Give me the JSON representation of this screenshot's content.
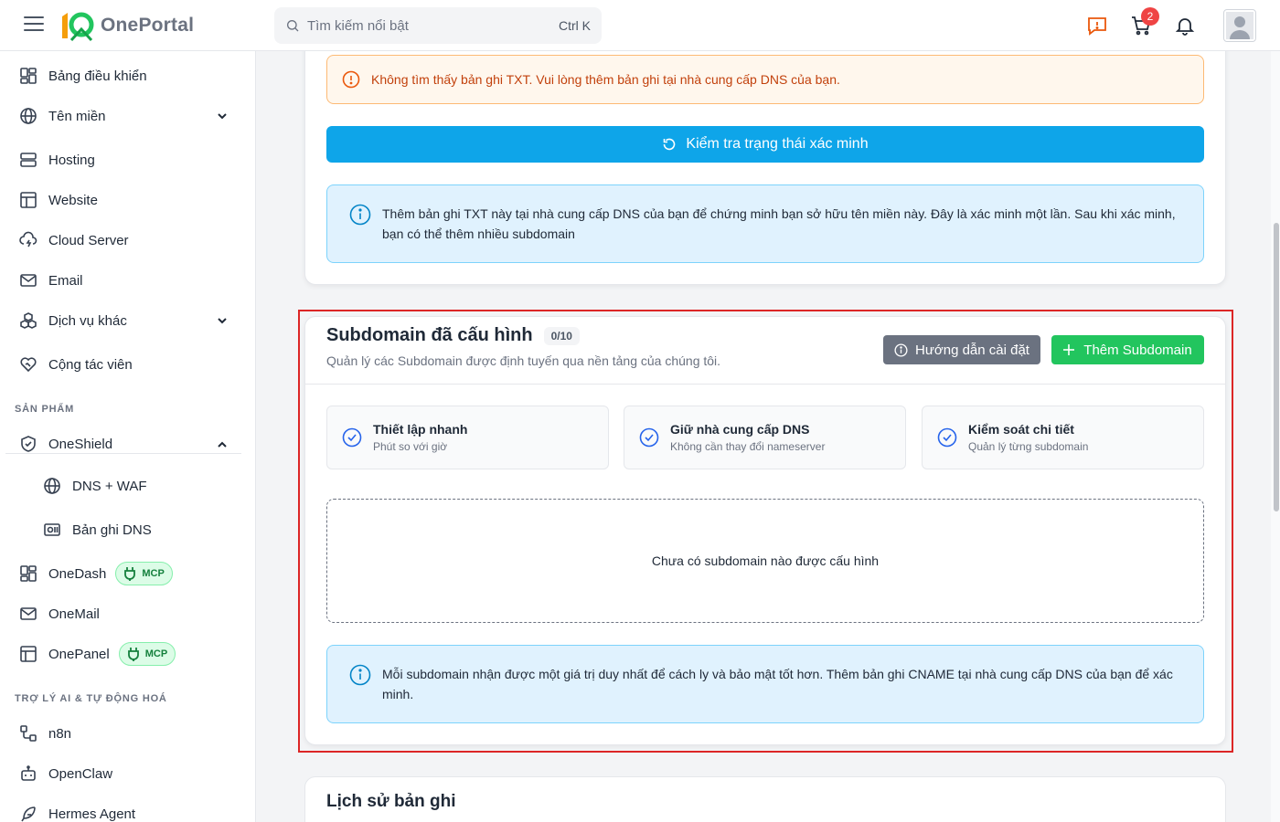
{
  "app": {
    "logo_text": "OnePortal",
    "search_placeholder": "Tìm kiếm nổi bật",
    "search_shortcut": "Ctrl K",
    "cart_count": "2",
    "colors": {
      "primary": "#0ea5e9",
      "success": "#22c55e",
      "danger": "#ef4444",
      "warning": "#c2410c"
    }
  },
  "sidebar": {
    "items": [
      {
        "label": "Bảng điều khiển",
        "icon": "dashboard-icon"
      },
      {
        "label": "Tên miền",
        "icon": "globe-icon",
        "expandable": true
      },
      {
        "label": "Hosting",
        "icon": "server-icon"
      },
      {
        "label": "Website",
        "icon": "website-icon"
      },
      {
        "label": "Cloud Server",
        "icon": "cloud-icon"
      },
      {
        "label": "Email",
        "icon": "mail-icon"
      },
      {
        "label": "Dịch vụ khác",
        "icon": "boxes-icon",
        "expandable": true
      },
      {
        "label": "Cộng tác viên",
        "icon": "heart-handshake-icon"
      }
    ],
    "section_products": "SẢN PHẨM",
    "products": [
      {
        "label": "OneShield",
        "icon": "shield-icon",
        "expanded": true
      },
      {
        "label": "DNS + WAF",
        "icon": "globe-icon"
      },
      {
        "label": "Bản ghi DNS",
        "icon": "dns-record-icon"
      },
      {
        "label": "OneDash",
        "icon": "dashboard-icon",
        "badge": "MCP"
      },
      {
        "label": "OneMail",
        "icon": "mail-icon"
      },
      {
        "label": "OnePanel",
        "icon": "panel-icon",
        "badge": "MCP"
      }
    ],
    "section_ai": "TRỢ LÝ AI & TỰ ĐỘNG HOÁ",
    "ai_items": [
      {
        "label": "n8n",
        "icon": "workflow-icon"
      },
      {
        "label": "OpenClaw",
        "icon": "bot-icon"
      },
      {
        "label": "Hermes Agent",
        "icon": "feather-icon"
      }
    ]
  },
  "verification": {
    "warning_text": "Không tìm thấy bản ghi TXT. Vui lòng thêm bản ghi tại nhà cung cấp DNS của bạn.",
    "check_button": "Kiểm tra trạng thái xác minh",
    "info_line1": "Thêm bản ghi TXT này tại nhà cung cấp DNS của bạn để chứng minh bạn sở hữu tên miền này. Đây là xác minh một lần. Sau khi xác minh,",
    "info_line2": "bạn có thể thêm nhiều subdomain"
  },
  "subdomains": {
    "title": "Subdomain đã cấu hình",
    "count": "0/10",
    "description": "Quản lý các Subdomain được định tuyến qua nền tảng của chúng tôi.",
    "guide_button": "Hướng dẫn cài đặt",
    "add_button": "Thêm Subdomain",
    "features": [
      {
        "title": "Thiết lập nhanh",
        "subtitle": "Phút so với giờ"
      },
      {
        "title": "Giữ nhà cung cấp DNS",
        "subtitle": "Không cần thay đổi nameserver"
      },
      {
        "title": "Kiểm soát chi tiết",
        "subtitle": "Quản lý từng subdomain"
      }
    ],
    "empty_text": "Chưa có subdomain nào được cấu hình",
    "info_line1": "Mỗi subdomain nhận được một giá trị duy nhất để cách ly và bảo mật tốt hơn. Thêm bản ghi CNAME tại nhà cung cấp DNS của bạn để xác",
    "info_line2": "minh."
  },
  "history": {
    "title": "Lịch sử bản ghi"
  }
}
